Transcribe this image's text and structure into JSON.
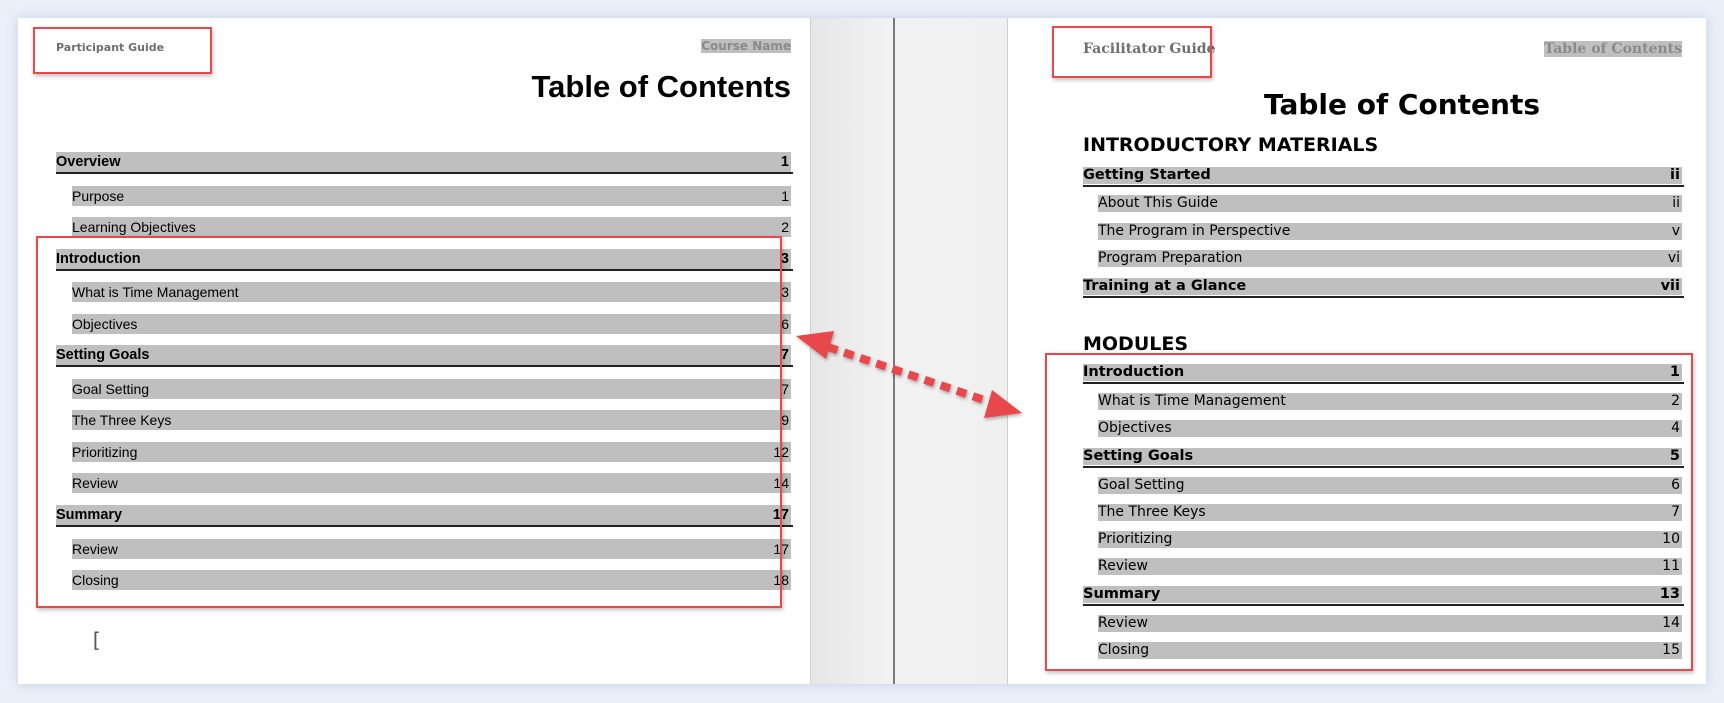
{
  "left_doc": {
    "header_guide": "Participant Guide",
    "header_course": "Course Name",
    "title": "Table of Contents",
    "entries": [
      {
        "label": "Overview",
        "page": "1"
      },
      {
        "label": "Purpose",
        "page": "1"
      },
      {
        "label": "Learning Objectives",
        "page": "2"
      },
      {
        "label": "Introduction",
        "page": "3"
      },
      {
        "label": "What is Time Management",
        "page": "3"
      },
      {
        "label": "Objectives",
        "page": "6"
      },
      {
        "label": "Setting Goals",
        "page": "7"
      },
      {
        "label": "Goal Setting",
        "page": "7"
      },
      {
        "label": "The Three Keys",
        "page": "9"
      },
      {
        "label": "Prioritizing",
        "page": "12"
      },
      {
        "label": "Review",
        "page": "14"
      },
      {
        "label": "Summary",
        "page": "17"
      },
      {
        "label": "Review",
        "page": "17"
      },
      {
        "label": "Closing",
        "page": "18"
      }
    ],
    "cursor_glyph": "["
  },
  "right_doc": {
    "header_guide": "Facilitator Guide",
    "header_section": "Table of Contents",
    "title": "Table of Contents",
    "section_intro": "INTRODUCTORY MATERIALS",
    "section_modules": "MODULES",
    "intro_entries": [
      {
        "label": "Getting Started",
        "page": "ii"
      },
      {
        "label": "About This Guide",
        "page": "ii"
      },
      {
        "label": "The Program in Perspective",
        "page": "v"
      },
      {
        "label": "Program Preparation",
        "page": "vi"
      },
      {
        "label": "Training at a Glance",
        "page": "vii"
      }
    ],
    "module_entries": [
      {
        "label": "Introduction",
        "page": "1"
      },
      {
        "label": "What is Time Management",
        "page": "2"
      },
      {
        "label": "Objectives",
        "page": "4"
      },
      {
        "label": "Setting Goals",
        "page": "5"
      },
      {
        "label": "Goal Setting",
        "page": "6"
      },
      {
        "label": "The Three Keys",
        "page": "7"
      },
      {
        "label": "Prioritizing",
        "page": "10"
      },
      {
        "label": "Review",
        "page": "11"
      },
      {
        "label": "Summary",
        "page": "13"
      },
      {
        "label": "Review",
        "page": "14"
      },
      {
        "label": "Closing",
        "page": "15"
      }
    ]
  },
  "colors": {
    "highlight_box": "#e8474c",
    "toc_shading": "#bfbfbf"
  }
}
